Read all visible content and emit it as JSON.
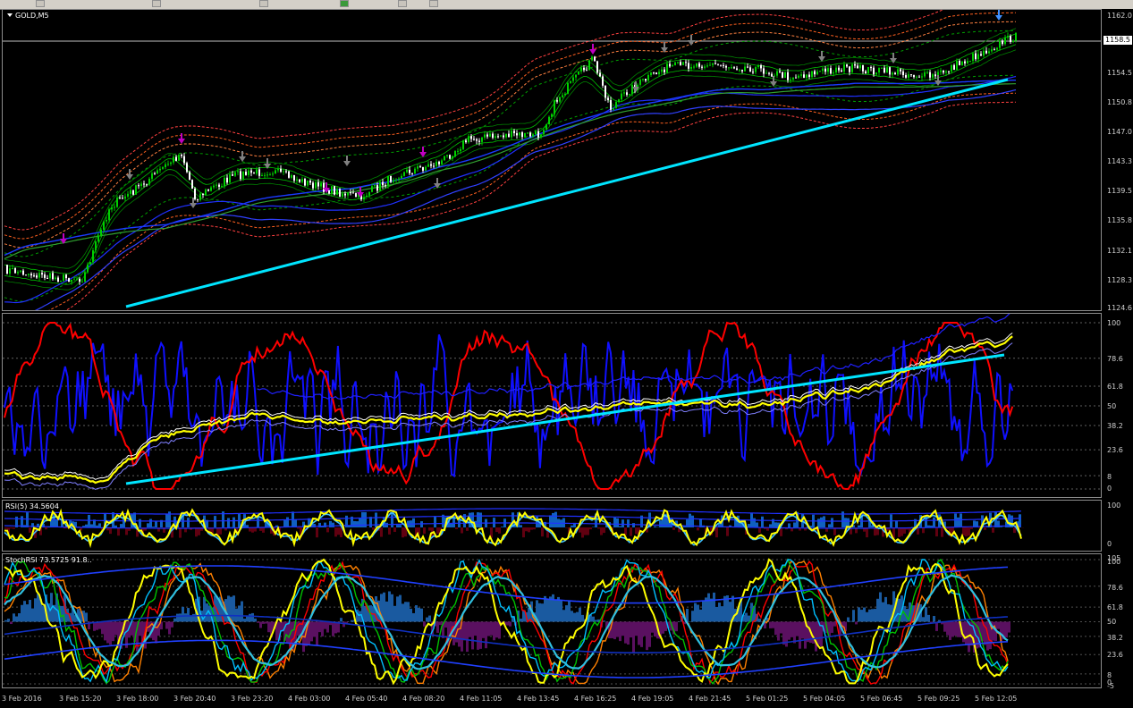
{
  "symbol": {
    "title": "GOLD,M5"
  },
  "current_price": "1158.5",
  "price_axis": {
    "labels": [
      "1162.0",
      "1154.5",
      "1150.8",
      "1147.0",
      "1143.3",
      "1139.5",
      "1135.8",
      "1132.1",
      "1128.3",
      "1124.6"
    ]
  },
  "osc1_axis": {
    "labels": [
      "100",
      "78.6",
      "61.8",
      "50",
      "38.2",
      "23.6",
      "8",
      "0"
    ]
  },
  "rsi": {
    "title": "RSI(5) 34.5604",
    "labels": [
      "100",
      "0"
    ]
  },
  "stochrsi": {
    "title": "StochRSI 73.5725 91.8..",
    "labels": [
      "105",
      "100",
      "78.6",
      "61.8",
      "50",
      "38.2",
      "23.6",
      "8",
      "0",
      "-5"
    ]
  },
  "time_axis": {
    "labels": [
      "3 Feb 2016",
      "3 Feb 15:20",
      "3 Feb 18:00",
      "3 Feb 20:40",
      "3 Feb 23:20",
      "4 Feb 03:00",
      "4 Feb 05:40",
      "4 Feb 08:20",
      "4 Feb 11:05",
      "4 Feb 13:45",
      "4 Feb 16:25",
      "4 Feb 19:05",
      "4 Feb 21:45",
      "5 Feb 01:25",
      "5 Feb 04:05",
      "5 Feb 06:45",
      "5 Feb 09:25",
      "5 Feb 12:05"
    ]
  },
  "colors": {
    "trendline": "#00e5ff",
    "candle_up": "#00c000",
    "rsi_red": "#ff0000",
    "rsi_blue": "#0000ff",
    "yellow": "#ffff00"
  }
}
